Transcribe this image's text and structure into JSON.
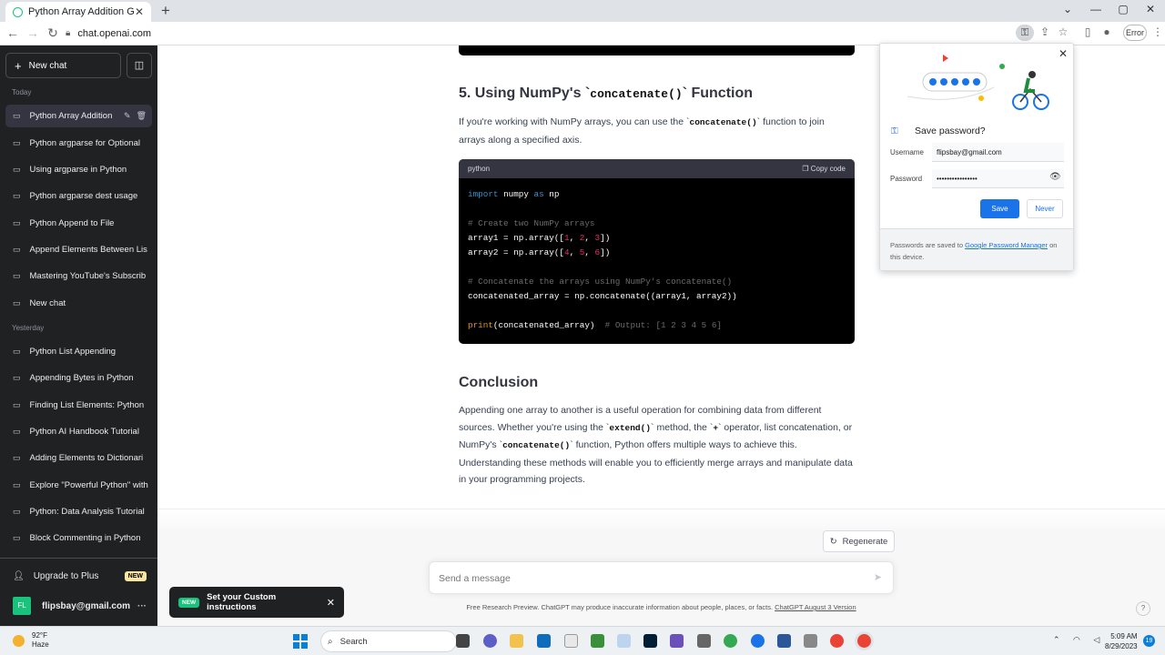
{
  "browser": {
    "tab_title": "Python Array Addition Guide",
    "tab_close": "✕",
    "new_tab": "+",
    "url": "chat.openai.com",
    "error_label": "Error"
  },
  "sidebar": {
    "new_chat": "New chat",
    "section_today": "Today",
    "section_yesterday": "Yesterday",
    "today": [
      "Python Array Addition",
      "Python argparse for Optional",
      "Using argparse in Python",
      "Python argparse dest usage",
      "Python Append to File",
      "Append Elements Between Lis",
      "Mastering YouTube's Subscrib",
      "New chat"
    ],
    "yesterday": [
      "Python List Appending",
      "Appending Bytes in Python",
      "Finding List Elements: Python",
      "Python AI Handbook Tutorial",
      "Adding Elements to Dictionari",
      "Explore \"Powerful Python\" with",
      "Python: Data Analysis Tutorial",
      "Block Commenting in Python"
    ],
    "upgrade": "Upgrade to Plus",
    "upgrade_badge": "NEW",
    "user_initials": "FL",
    "user_email": "flipsbay@gmail.com",
    "more": "···"
  },
  "content": {
    "heading5_prefix": "5. Using NumPy's `",
    "heading5_code": "concatenate()",
    "heading5_suffix": "` Function",
    "p1_a": "If you're working with NumPy arrays, you can use the `",
    "p1_code": "concatenate()",
    "p1_b": "` function to join arrays along a specified axis.",
    "code_lang": "python",
    "copy_code": "Copy code",
    "conclusion_heading": "Conclusion",
    "c1": "Appending one array to another is a useful operation for combining data from different sources. Whether you're using the `",
    "c1_code": "extend()",
    "c2": "` method, the `",
    "c2_code": "+",
    "c3": "` operator, list concatenation, or NumPy's `",
    "c3_code": "concatenate()",
    "c4": "` function, Python offers multiple ways to achieve this. Understanding these methods will enable you to efficiently merge arrays and manipulate data in your programming projects."
  },
  "code": {
    "import": "import",
    "numpy": " numpy ",
    "as": "as",
    "np": " np",
    "comment1": "# Create two NumPy arrays",
    "a1_pre": "array1 = np.array([",
    "a1_vals": [
      "1",
      "2",
      "3"
    ],
    "a2_pre": "array2 = np.array([",
    "a2_vals": [
      "4",
      "5",
      "6"
    ],
    "close": "])",
    "comment2": "# Concatenate the arrays using NumPy's concatenate()",
    "concat": "concatenated_array = np.concatenate((array1, array2))",
    "print": "print",
    "print_arg": "(concatenated_array)  ",
    "comment3": "# Output: [1 2 3 4 5 6]"
  },
  "footer": {
    "regenerate": "Regenerate",
    "placeholder": "Send a message",
    "disclaimer": "Free Research Preview. ChatGPT may produce inaccurate information about people, places, or facts.",
    "version_link": "ChatGPT August 3 Version",
    "help": "?"
  },
  "toast": {
    "badge": "NEW",
    "text": "Set your Custom instructions",
    "close": "✕"
  },
  "password_popup": {
    "title": "Save password?",
    "username_label": "Username",
    "username_value": "flipsbay@gmail.com",
    "password_label": "Password",
    "password_value": "••••••••••••••••",
    "save": "Save",
    "never": "Never",
    "footer_a": "Passwords are saved to ",
    "footer_link": "Google Password Manager",
    "footer_b": " on this device."
  },
  "taskbar": {
    "temp": "92°F",
    "condition": "Haze",
    "search": "Search",
    "time": "5:09 AM",
    "date": "8/29/2023",
    "notif_count": "19"
  },
  "colors": {
    "sidebar_bg": "#202123",
    "accent_green": "#19c37d",
    "google_blue": "#1a73e8"
  }
}
